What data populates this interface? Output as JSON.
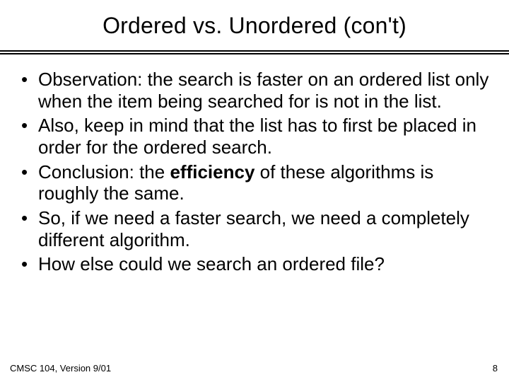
{
  "title": "Ordered vs. Unordered (con't)",
  "bullets": [
    {
      "pre": "Observation:  the search is faster on an ordered list only when the item being searched for is not in the list."
    },
    {
      "pre": "Also, keep in mind that the list has to first be placed in order for the ordered search."
    },
    {
      "pre": "Conclusion:  the ",
      "bold": "efficiency",
      "post": " of these algorithms is roughly the same."
    },
    {
      "pre": "So, if we need a faster search, we need a completely different algorithm."
    },
    {
      "pre": "How else could we search an ordered file?"
    }
  ],
  "footer": {
    "left": "CMSC 104, Version 9/01",
    "right": "8"
  }
}
